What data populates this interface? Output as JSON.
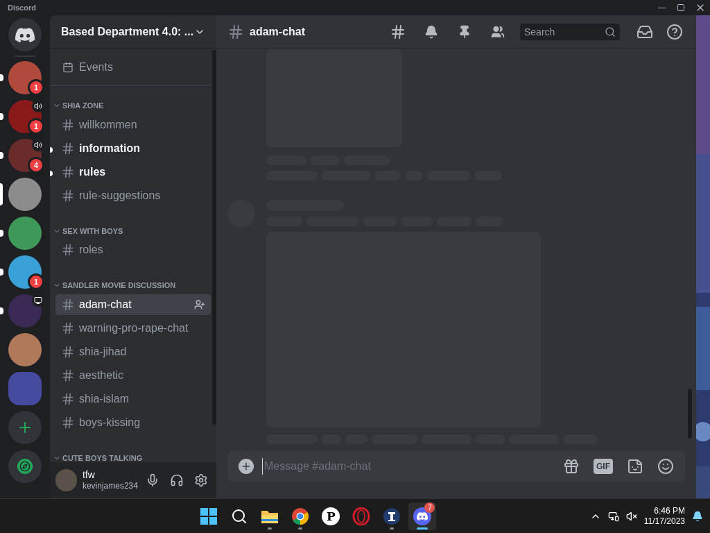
{
  "window": {
    "title": "Discord"
  },
  "servers": [
    {
      "kind": "avatar",
      "color": "#b04a3c",
      "badge": "1",
      "unread": true,
      "selected": false,
      "in_voice": false,
      "streaming": false
    },
    {
      "kind": "avatar",
      "color": "#8a1a1a",
      "badge": "1",
      "unread": true,
      "selected": false,
      "in_voice": true,
      "streaming": false
    },
    {
      "kind": "avatar",
      "color": "#6a2b2b",
      "badge": "4",
      "unread": true,
      "selected": false,
      "in_voice": true,
      "streaming": false
    },
    {
      "kind": "avatar",
      "color": "#8c8c8c",
      "unread": false,
      "selected": true,
      "in_voice": false,
      "streaming": false
    },
    {
      "kind": "avatar",
      "color": "#3f9a5a",
      "unread": true,
      "selected": false,
      "in_voice": false,
      "streaming": false
    },
    {
      "kind": "avatar",
      "color": "#3aa0d8",
      "badge": "1",
      "unread": true,
      "selected": false,
      "in_voice": false,
      "streaming": false
    },
    {
      "kind": "avatar",
      "color": "#3a2a55",
      "unread": true,
      "selected": false,
      "in_voice": false,
      "streaming": true
    },
    {
      "kind": "avatar",
      "color": "#b07a5a",
      "unread": false,
      "selected": false,
      "in_voice": false,
      "streaming": false
    },
    {
      "kind": "square",
      "color": "#454a9e",
      "unread": false,
      "selected": false,
      "in_voice": false,
      "streaming": false
    }
  ],
  "server_header": {
    "name": "Based Department 4.0: ..."
  },
  "events_label": "Events",
  "categories": [
    {
      "name": "SHIA ZONE",
      "channels": [
        {
          "name": "willkommen",
          "unread": false,
          "selected": false
        },
        {
          "name": "information",
          "unread": true,
          "selected": false
        },
        {
          "name": "rules",
          "unread": true,
          "selected": false
        },
        {
          "name": "rule-suggestions",
          "unread": false,
          "selected": false
        }
      ]
    },
    {
      "name": "SEX WITH BOYS",
      "channels": [
        {
          "name": "roles",
          "unread": false,
          "selected": false
        }
      ]
    },
    {
      "name": "SANDLER MOVIE DISCUSSION",
      "channels": [
        {
          "name": "adam-chat",
          "unread": false,
          "selected": true
        },
        {
          "name": "warning-pro-rape-chat",
          "unread": false,
          "selected": false
        },
        {
          "name": "shia-jihad",
          "unread": false,
          "selected": false
        },
        {
          "name": "aesthetic",
          "unread": false,
          "selected": false
        },
        {
          "name": "shia-islam",
          "unread": false,
          "selected": false
        },
        {
          "name": "boys-kissing",
          "unread": false,
          "selected": false
        }
      ]
    },
    {
      "name": "CUTE BOYS TALKING"
    }
  ],
  "user": {
    "display_name": "tfw",
    "username": "kevinjames234"
  },
  "chat_header": {
    "channel": "adam-chat",
    "search_placeholder": "Search"
  },
  "composer": {
    "placeholder": "Message #adam-chat",
    "gif_label": "GIF"
  },
  "taskbar": {
    "apps": [
      {
        "kind": "explorer",
        "running": true,
        "active": false
      },
      {
        "kind": "chrome",
        "running": true,
        "active": false
      },
      {
        "kind": "p",
        "label": "P",
        "running": false,
        "active": false
      },
      {
        "kind": "opera",
        "running": false,
        "active": false
      },
      {
        "kind": "pillar",
        "running": true,
        "active": false
      },
      {
        "kind": "discord",
        "running": true,
        "active": true,
        "badge": "7"
      }
    ],
    "time": "6:46 PM",
    "date": "11/17/2023"
  }
}
